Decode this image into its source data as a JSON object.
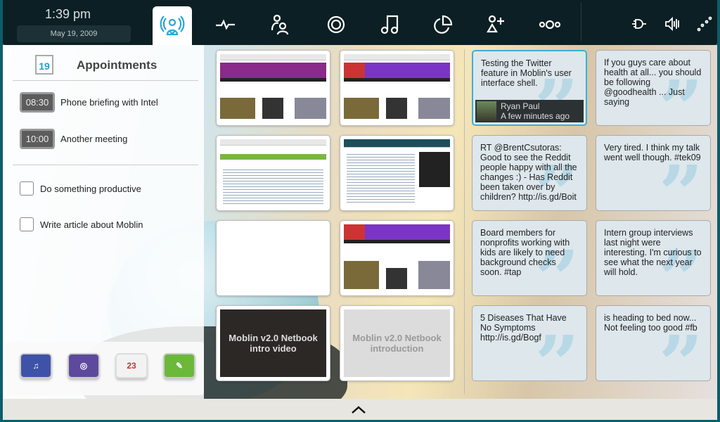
{
  "topbar": {
    "time": "1:39 pm",
    "date": "May 19, 2009",
    "tabs": [
      {
        "name": "myzone",
        "icon": "myzone-icon",
        "active": true
      },
      {
        "name": "status",
        "icon": "pulse-icon"
      },
      {
        "name": "people",
        "icon": "people-icon"
      },
      {
        "name": "internet",
        "icon": "internet-icon"
      },
      {
        "name": "media",
        "icon": "music-icon"
      },
      {
        "name": "pasteboard",
        "icon": "pie-icon"
      },
      {
        "name": "applications",
        "icon": "add-user-icon"
      },
      {
        "name": "zones",
        "icon": "zones-icon"
      }
    ],
    "status": [
      {
        "icon": "power-plug-icon"
      },
      {
        "icon": "volume-icon"
      },
      {
        "icon": "network-icon"
      }
    ],
    "accent": "#29a6d6"
  },
  "appointments": {
    "title": "Appointments",
    "calendar_day": "19",
    "events": [
      {
        "time": "08:30",
        "label": "Phone briefing with Intel"
      },
      {
        "time": "10:00",
        "label": "Another meeting"
      }
    ],
    "tasks": [
      {
        "label": "Do something productive",
        "done": false
      },
      {
        "label": "Write article about Moblin",
        "done": false
      }
    ]
  },
  "apps": [
    {
      "name": "music",
      "icon": "music-app-icon",
      "color": "#3e53a8"
    },
    {
      "name": "photos",
      "icon": "photos-app-icon",
      "color": "#5e4a9c"
    },
    {
      "name": "calendar",
      "icon": "calendar-app-icon",
      "text": "23",
      "color": "#d22d3a"
    },
    {
      "name": "tasks",
      "icon": "tasks-app-icon",
      "color": "#6cb83a"
    }
  ],
  "web": {
    "videos": [
      {
        "label": "Moblin v2.0 Netbook intro video"
      },
      {
        "label": "Moblin v2.0 Netbook introduction"
      }
    ]
  },
  "tweets": [
    {
      "text": "Testing the Twitter feature in Moblin's user interface shell.",
      "author": "Ryan Paul",
      "when": "A few minutes ago"
    },
    {
      "text": "If you guys care about health at all... you should be following @goodhealth ... Just saying"
    },
    {
      "text": "RT @BrentCsutoras: Good to see the Reddit people happy with all the changes :) - Has Reddit been taken over by children? http://is.gd/Boit"
    },
    {
      "text": "Very tired. I think my talk went well though. #tek09"
    },
    {
      "text": "Board members for nonprofits working with kids are likely to need background checks soon. #tap"
    },
    {
      "text": "Intern group interviews last night were interesting. I'm curious to see what the next year will hold."
    },
    {
      "text": "5 Diseases That Have No Symptoms http://is.gd/Bogf"
    },
    {
      "text": "is heading to bed now... Not feeling too good #fb"
    }
  ]
}
